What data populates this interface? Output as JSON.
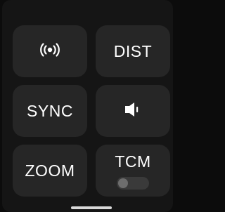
{
  "tiles": {
    "broadcast": {
      "icon": "broadcast-icon"
    },
    "dist": {
      "label": "DIST"
    },
    "sync": {
      "label": "SYNC"
    },
    "speaker": {
      "icon": "speaker-icon"
    },
    "zoom": {
      "label": "ZOOM"
    },
    "tcm": {
      "label": "TCM",
      "toggle_on": false
    }
  },
  "colors": {
    "background": "#151515",
    "tile": "#262626",
    "text": "#ffffff",
    "toggle_track": "#3a3a3a",
    "toggle_knob": "#6d6d6d"
  }
}
